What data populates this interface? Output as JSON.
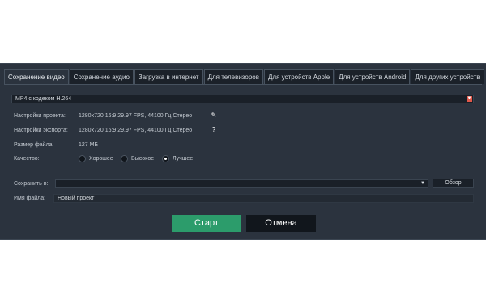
{
  "tabs": [
    {
      "label": "Сохранение видео",
      "active": true
    },
    {
      "label": "Сохранение аудио",
      "active": false
    },
    {
      "label": "Загрузка в интернет",
      "active": false
    },
    {
      "label": "Для телевизоров",
      "active": false
    },
    {
      "label": "Для устройств Apple",
      "active": false
    },
    {
      "label": "Для устройств Android",
      "active": false
    },
    {
      "label": "Для других устройств",
      "active": false
    }
  ],
  "format": {
    "selected": "MP4 с кодеком H.264",
    "arrow": "▼"
  },
  "project_settings": {
    "label": "Настройки проекта:",
    "value": "1280x720 16:9 29.97 FPS, 44100 Гц Стерео",
    "icon": "pencil-icon",
    "glyph": "✎"
  },
  "export_settings": {
    "label": "Настройки экспорта:",
    "value": "1280x720 16:9 29.97 FPS, 44100 Гц Стерео",
    "icon": "help-icon",
    "glyph": "?"
  },
  "file_size": {
    "label": "Размер файла:",
    "value": "127 МБ"
  },
  "quality": {
    "label": "Качество:",
    "options": [
      {
        "label": "Хорошее",
        "checked": false
      },
      {
        "label": "Высокое",
        "checked": false
      },
      {
        "label": "Лучшее",
        "checked": true
      }
    ]
  },
  "save_to": {
    "label": "Сохранить в:",
    "value": "",
    "arrow": "▼",
    "browse_label": "Обзор"
  },
  "file_name": {
    "label": "Имя файла:",
    "value": "Новый проект"
  },
  "buttons": {
    "start_label": "Старт",
    "cancel_label": "Отмена"
  },
  "colors": {
    "accent_green": "#2c9c6b",
    "dropdown_accent": "#e2584a",
    "background": "#2b333e"
  }
}
